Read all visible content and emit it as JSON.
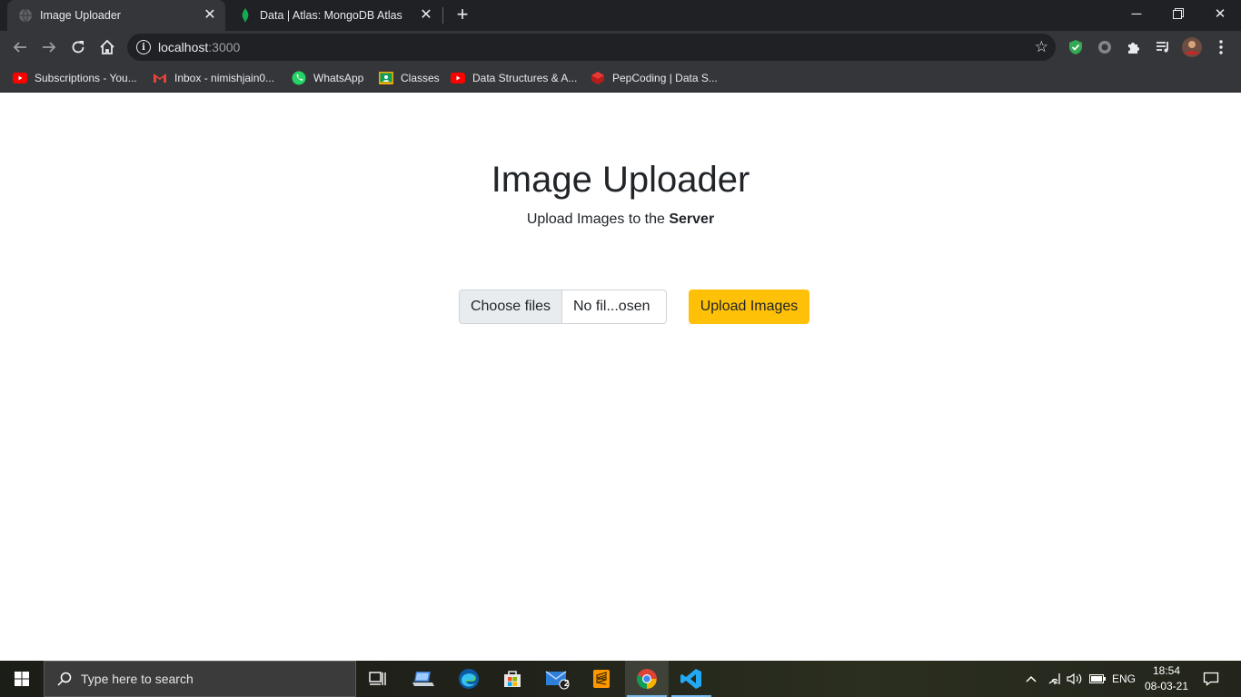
{
  "browser": {
    "tabs": [
      {
        "title": "Image Uploader",
        "active": true
      },
      {
        "title": "Data | Atlas: MongoDB Atlas",
        "active": false
      }
    ],
    "url_host": "localhost",
    "url_port": ":3000",
    "bookmarks": [
      {
        "label": "Subscriptions - You...",
        "icon": "youtube-icon"
      },
      {
        "label": "Inbox - nimishjain0...",
        "icon": "gmail-icon"
      },
      {
        "label": "WhatsApp",
        "icon": "whatsapp-icon"
      },
      {
        "label": "Classes",
        "icon": "classroom-icon"
      },
      {
        "label": "Data Structures & A...",
        "icon": "youtube-icon"
      },
      {
        "label": "PepCoding | Data S...",
        "icon": "pepcoding-icon"
      }
    ]
  },
  "page": {
    "heading": "Image Uploader",
    "subtitle_prefix": "Upload Images to the ",
    "subtitle_bold": "Server",
    "choose_label": "Choose files",
    "no_file_label": "No fil...osen",
    "upload_label": "Upload Images",
    "accent_color": "#ffc107"
  },
  "taskbar": {
    "search_placeholder": "Type here to search",
    "mail_badge": "2",
    "language": "ENG",
    "time": "18:54",
    "date": "08-03-21"
  }
}
